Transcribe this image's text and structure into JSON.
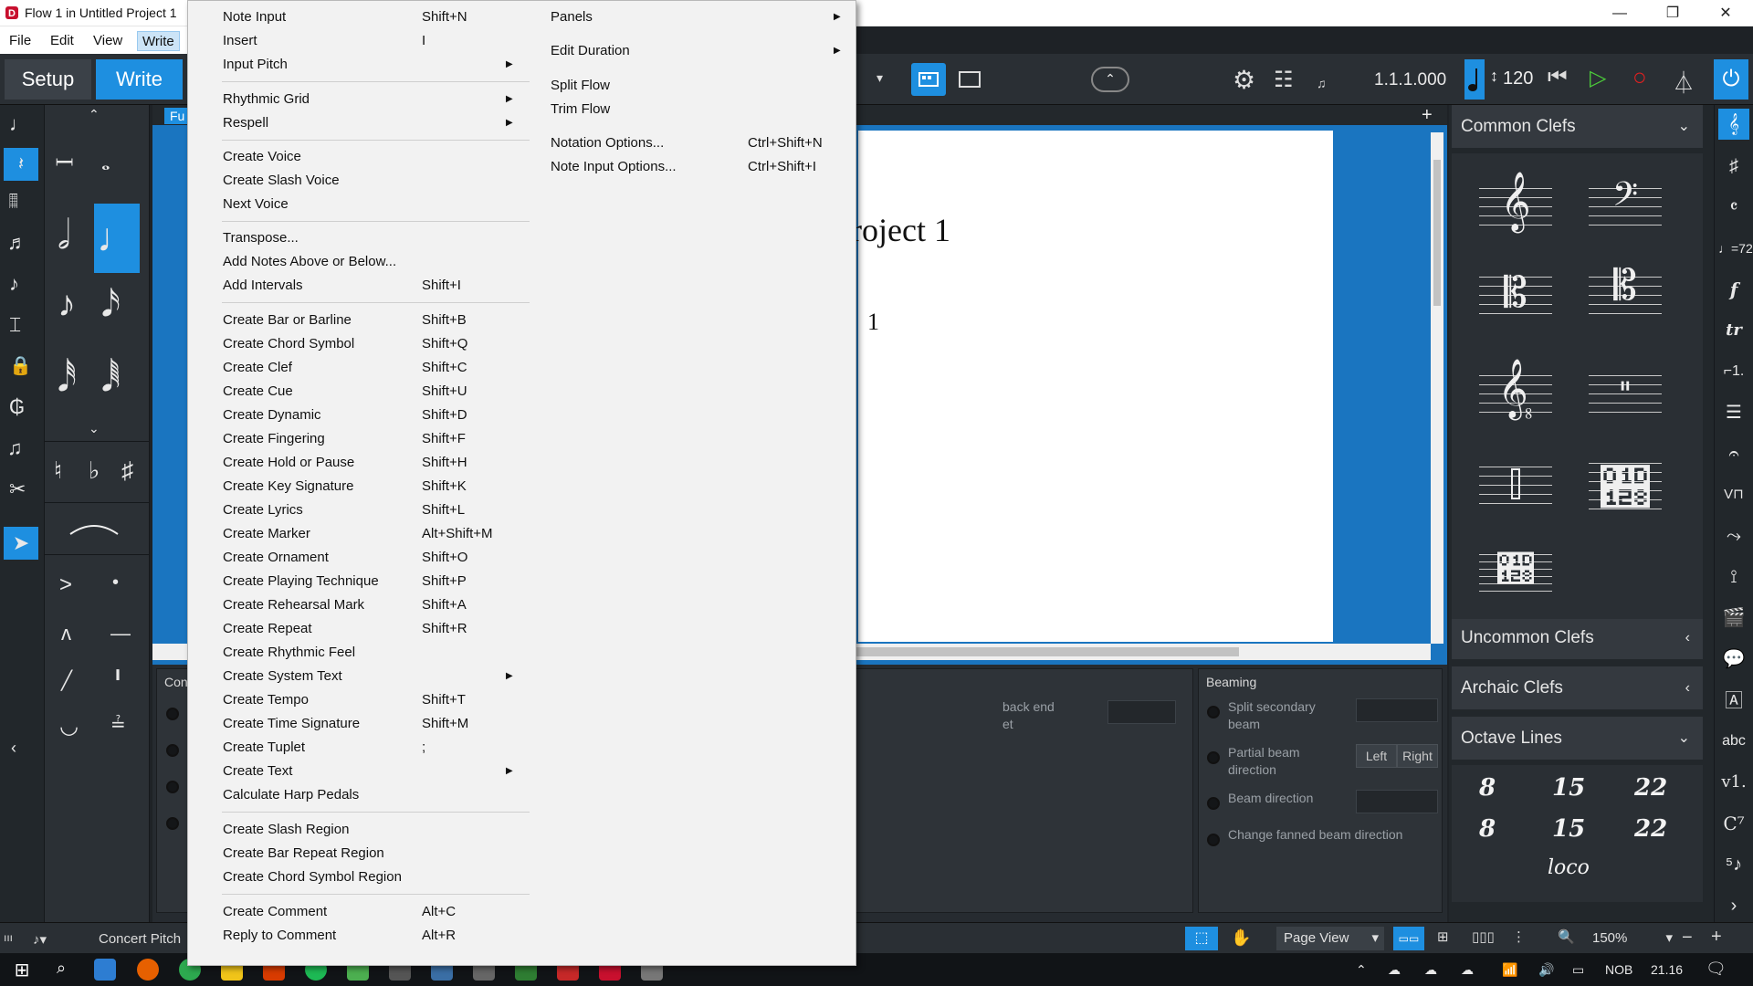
{
  "window": {
    "title": "Flow 1 in Untitled Project 1",
    "minimize": "—",
    "restore": "❐",
    "close": "✕"
  },
  "menubar": {
    "file": "File",
    "edit": "Edit",
    "view": "View",
    "write": "Write"
  },
  "toolbar": {
    "setup_tab": "Setup",
    "write_tab": "Write",
    "position": "1.1.1.000",
    "tempo": "120"
  },
  "score": {
    "title_fragment": "roject 1",
    "subtitle_fragment": "1",
    "tab_fragment": "Fu"
  },
  "write_menu": {
    "col1": [
      {
        "label": "Note Input",
        "shortcut": "Shift+N"
      },
      {
        "label": "Insert",
        "shortcut": "I"
      },
      {
        "label": "Input Pitch",
        "submenu": true
      },
      {
        "label": "Rhythmic Grid",
        "submenu": true
      },
      {
        "label": "Respell",
        "submenu": true
      },
      {
        "label": "Create Voice"
      },
      {
        "label": "Create Slash Voice"
      },
      {
        "label": "Next Voice"
      },
      {
        "label": "Transpose..."
      },
      {
        "label": "Add Notes Above or Below..."
      },
      {
        "label": "Add Intervals",
        "shortcut": "Shift+I"
      },
      {
        "label": "Create Bar or Barline",
        "shortcut": "Shift+B"
      },
      {
        "label": "Create Chord Symbol",
        "shortcut": "Shift+Q"
      },
      {
        "label": "Create Clef",
        "shortcut": "Shift+C"
      },
      {
        "label": "Create Cue",
        "shortcut": "Shift+U"
      },
      {
        "label": "Create Dynamic",
        "shortcut": "Shift+D"
      },
      {
        "label": "Create Fingering",
        "shortcut": "Shift+F"
      },
      {
        "label": "Create Hold or Pause",
        "shortcut": "Shift+H"
      },
      {
        "label": "Create Key Signature",
        "shortcut": "Shift+K"
      },
      {
        "label": "Create Lyrics",
        "shortcut": "Shift+L"
      },
      {
        "label": "Create Marker",
        "shortcut": "Alt+Shift+M"
      },
      {
        "label": "Create Ornament",
        "shortcut": "Shift+O"
      },
      {
        "label": "Create Playing Technique",
        "shortcut": "Shift+P"
      },
      {
        "label": "Create Rehearsal Mark",
        "shortcut": "Shift+A"
      },
      {
        "label": "Create Repeat",
        "shortcut": "Shift+R"
      },
      {
        "label": "Create Rhythmic Feel"
      },
      {
        "label": "Create System Text",
        "submenu": true
      },
      {
        "label": "Create Tempo",
        "shortcut": "Shift+T"
      },
      {
        "label": "Create Time Signature",
        "shortcut": "Shift+M"
      },
      {
        "label": "Create Tuplet",
        "shortcut": ";"
      },
      {
        "label": "Create Text",
        "submenu": true
      },
      {
        "label": "Calculate Harp Pedals"
      },
      {
        "label": "Create Slash Region"
      },
      {
        "label": "Create Bar Repeat Region"
      },
      {
        "label": "Create Chord Symbol Region"
      },
      {
        "label": "Create Comment",
        "shortcut": "Alt+C"
      },
      {
        "label": "Reply to Comment",
        "shortcut": "Alt+R"
      }
    ],
    "col2": [
      {
        "label": "Panels",
        "submenu": true
      },
      {
        "label": "Edit Duration",
        "submenu": true
      },
      {
        "label": "Split Flow"
      },
      {
        "label": "Trim Flow"
      },
      {
        "label": "Notation Options...",
        "shortcut": "Ctrl+Shift+N"
      },
      {
        "label": "Note Input Options...",
        "shortcut": "Ctrl+Shift+I"
      }
    ]
  },
  "lower_zone": {
    "left_title_fragment": "Con",
    "mid_label_fragment_1": "back end",
    "mid_label_fragment_2": "et",
    "beaming_title": "Beaming",
    "options": [
      {
        "label": "Split secondary beam"
      },
      {
        "label": "Partial beam direction",
        "left": "Left",
        "right": "Right"
      },
      {
        "label": "Beam direction"
      },
      {
        "label": "Change fanned beam direction"
      }
    ]
  },
  "right_panel": {
    "common_clefs": "Common Clefs",
    "uncommon_clefs": "Uncommon Clefs",
    "archaic_clefs": "Archaic Clefs",
    "octave_lines": "Octave Lines",
    "octave_items": [
      "8",
      "15",
      "22",
      "8",
      "15",
      "22",
      "loco"
    ]
  },
  "statusbar": {
    "concert_pitch": "Concert Pitch",
    "view_mode": "Page View",
    "zoom": "150%"
  },
  "taskbar": {
    "language": "NOB",
    "time": "21.16"
  }
}
